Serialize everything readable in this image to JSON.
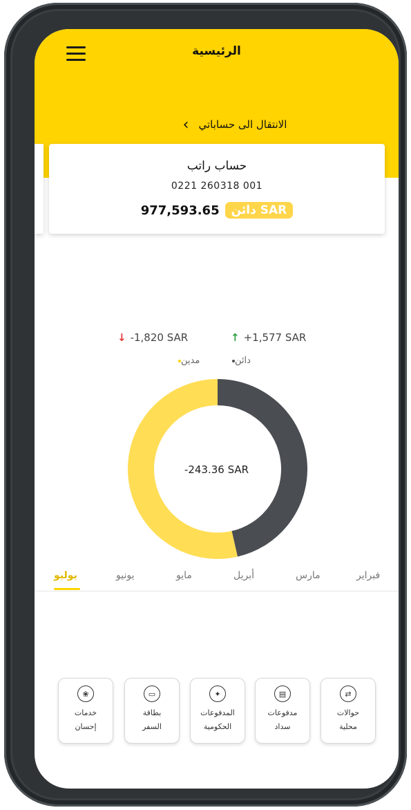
{
  "header": {
    "title": "الرئيسية",
    "nav_label": "الانتقال الى حساباتي",
    "nav_chevron": "‹"
  },
  "account": {
    "name": "حساب راتب",
    "number": "0221 260318 001",
    "badge": "دائن SAR",
    "balance": "977,593.65"
  },
  "summary": {
    "debit_amount": "-1,820 SAR",
    "credit_amount": "+1,577 SAR",
    "legend_debit": "مدين",
    "legend_credit": "دائن",
    "net": "-243.36 SAR"
  },
  "chart_data": {
    "type": "pie",
    "donut": true,
    "categories": [
      "دائن",
      "مدين"
    ],
    "values": [
      1577,
      1820
    ],
    "colors": [
      "#4a4d52",
      "#ffdd55"
    ]
  },
  "months": [
    "فبراير",
    "مارس",
    "أبريل",
    "مايو",
    "يونيو",
    "يوليو"
  ],
  "active_month": "يوليو",
  "services": [
    {
      "line1": "حوالات",
      "line2": "محلية",
      "icon": "transfer-icon"
    },
    {
      "line1": "مدفوعات",
      "line2": "سداد",
      "icon": "bill-icon"
    },
    {
      "line1": "المدفوعات",
      "line2": "الحكومية",
      "icon": "government-emblem-icon"
    },
    {
      "line1": "بطاقة",
      "line2": "السفر",
      "icon": "card-icon"
    },
    {
      "line1": "خدمات",
      "line2": "إحسان",
      "icon": "charity-icon"
    }
  ],
  "colors": {
    "header_yellow": "#ffd400",
    "badge_yellow": "#ffd54a",
    "debit_red": "#e53935",
    "credit_green": "#2ea043"
  }
}
